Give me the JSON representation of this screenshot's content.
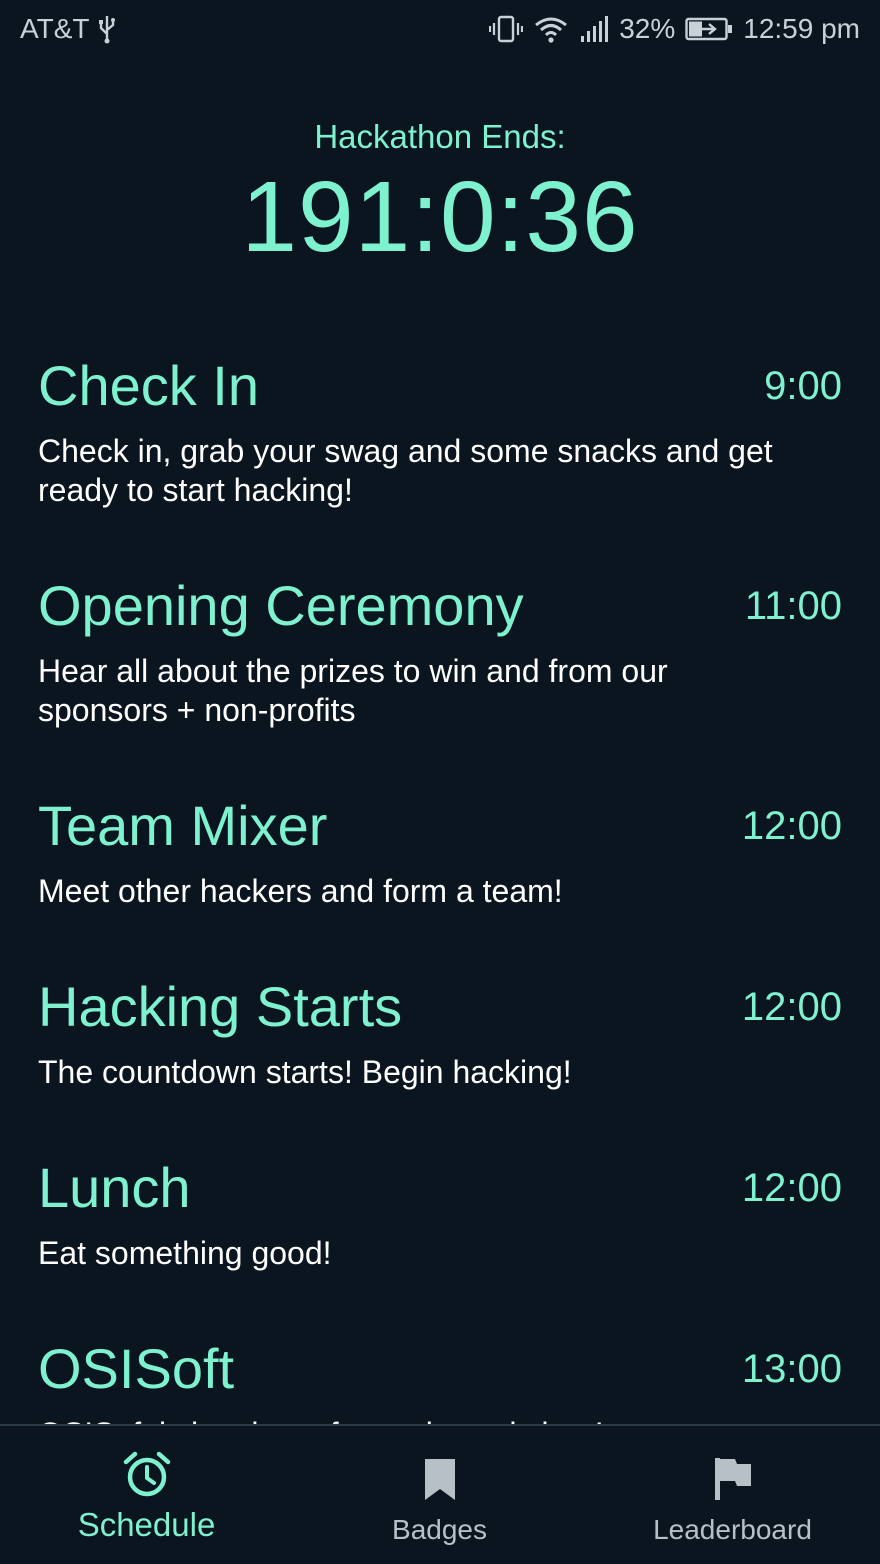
{
  "status_bar": {
    "carrier": "AT&T",
    "battery_percent": "32%",
    "time": "12:59 pm",
    "icons": [
      "usb-icon",
      "vibrate-icon",
      "wifi-icon",
      "signal-icon",
      "battery-charging-icon"
    ]
  },
  "countdown": {
    "label": "Hackathon Ends:",
    "value": "191:0:36"
  },
  "schedule": {
    "events": [
      {
        "title": "Check In",
        "time": "9:00",
        "description": "Check in, grab your swag and some snacks and get ready to start hacking!"
      },
      {
        "title": "Opening Ceremony",
        "time": "11:00",
        "description": "Hear all about the prizes to win and from our sponsors + non-profits"
      },
      {
        "title": "Team Mixer",
        "time": "12:00",
        "description": "Meet other hackers and form a team!"
      },
      {
        "title": "Hacking Starts",
        "time": "12:00",
        "description": "The countdown starts! Begin hacking!"
      },
      {
        "title": "Lunch",
        "time": "12:00",
        "description": "Eat something good!"
      },
      {
        "title": "OSISoft",
        "time": "13:00",
        "description": "OSISoft is hosting a fantastic workshop!"
      }
    ]
  },
  "bottom_nav": {
    "items": [
      {
        "label": "Schedule",
        "icon": "alarm-clock-icon",
        "active": true
      },
      {
        "label": "Badges",
        "icon": "bookmark-icon",
        "active": false
      },
      {
        "label": "Leaderboard",
        "icon": "flag-icon",
        "active": false
      }
    ]
  },
  "colors": {
    "background": "#0b1520",
    "accent": "#7ef2cf",
    "text": "#ffffff",
    "inactive": "#b7c0c6"
  }
}
